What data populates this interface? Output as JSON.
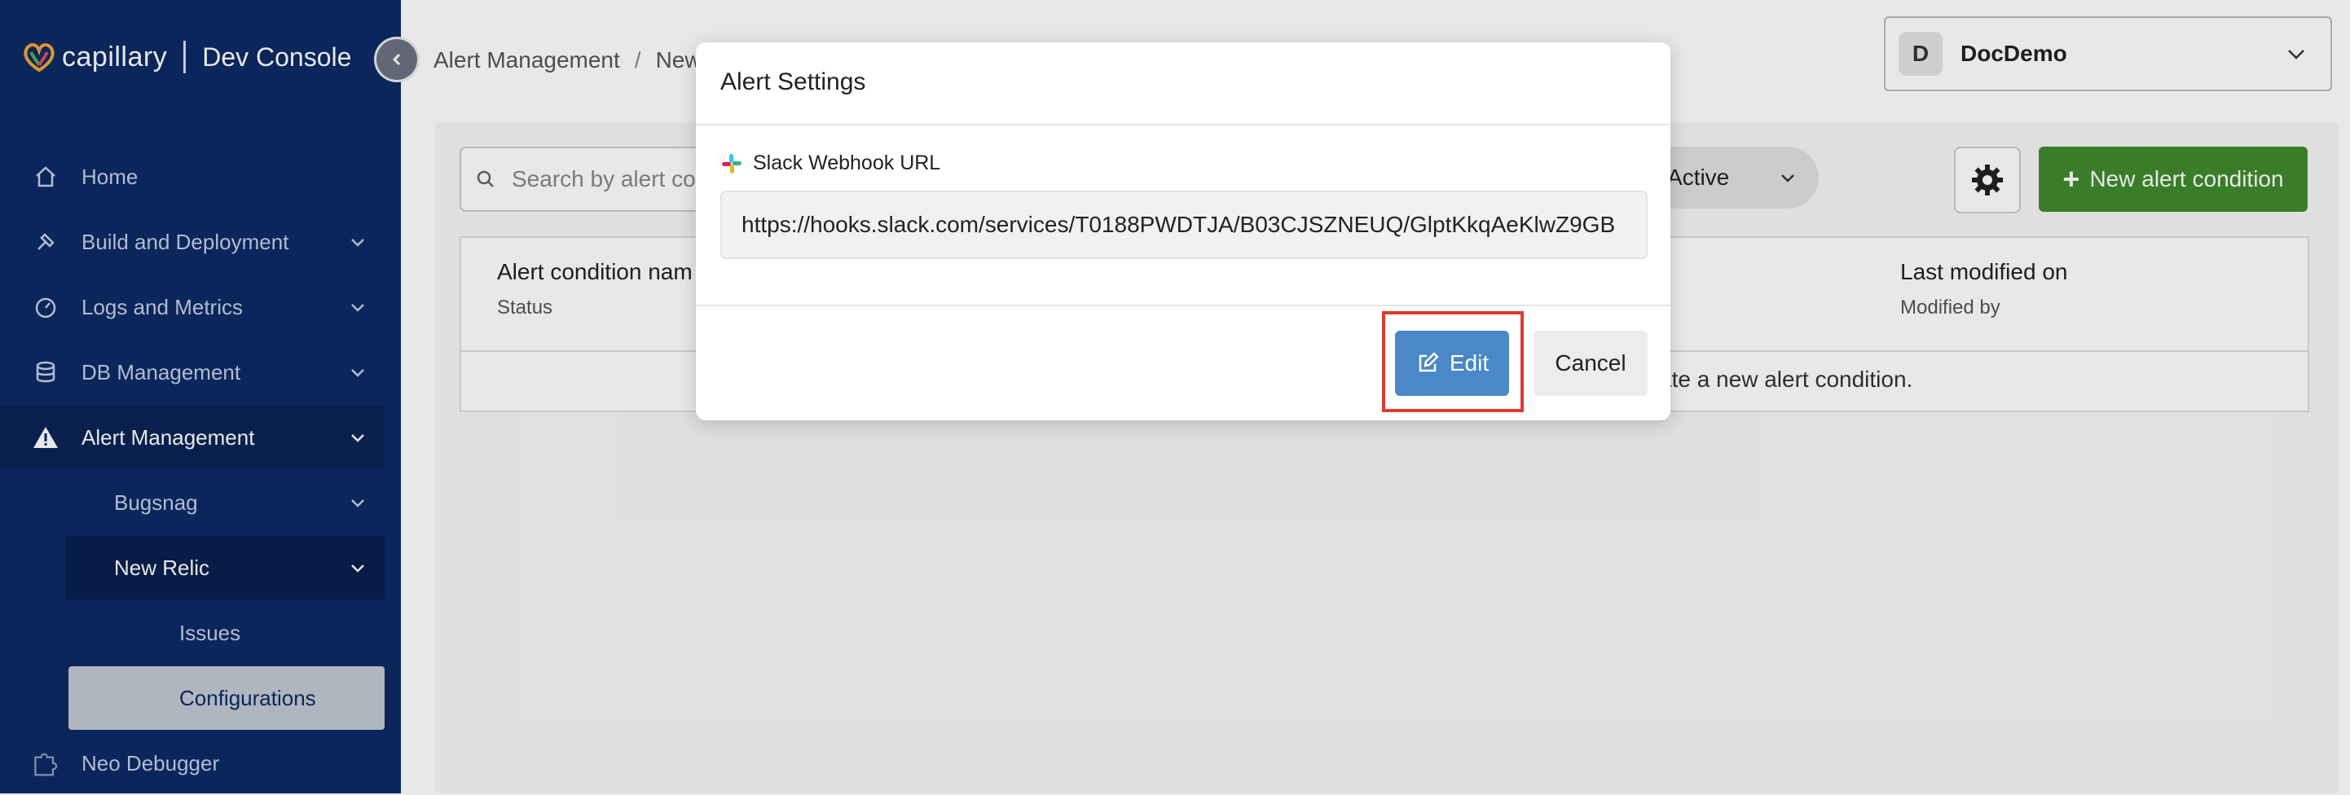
{
  "brand": {
    "name": "capillary",
    "console": "Dev Console"
  },
  "sidebar": {
    "items": [
      {
        "label": "Home",
        "icon": "home-icon"
      },
      {
        "label": "Build and Deployment",
        "icon": "hammer-icon"
      },
      {
        "label": "Logs and Metrics",
        "icon": "gauge-icon"
      },
      {
        "label": "DB Management",
        "icon": "database-icon"
      },
      {
        "label": "Alert Management",
        "icon": "warning-icon"
      }
    ],
    "sub_items": [
      {
        "label": "Bugsnag"
      },
      {
        "label": "New Relic"
      },
      {
        "label": "Issues"
      },
      {
        "label": "Configurations"
      }
    ],
    "neo_debugger": "Neo Debugger"
  },
  "header": {
    "breadcrumb": [
      "Alert Management",
      "New"
    ],
    "org": {
      "initial": "D",
      "name": "DocDemo"
    }
  },
  "toolbar": {
    "search_placeholder": "Search by alert co",
    "status": "Active",
    "new_button": "New alert condition"
  },
  "table": {
    "col1_title": "Alert condition nam",
    "col1_sub": "Status",
    "col2_title": "Last modified on",
    "col2_sub": "Modified by",
    "empty_message": "ate a new alert condition."
  },
  "modal": {
    "title": "Alert Settings",
    "field_label": "Slack Webhook URL",
    "field_value": "https://hooks.slack.com/services/T0188PWDTJA/B03CJSZNEUQ/GlptKkqAeKlwZ9GB",
    "edit_label": "Edit",
    "cancel_label": "Cancel"
  },
  "colors": {
    "sidebar_bg": "#0c2a63",
    "primary_button": "#4a88c7",
    "success_button": "#3f8a2c",
    "highlight": "#e03a2e"
  }
}
